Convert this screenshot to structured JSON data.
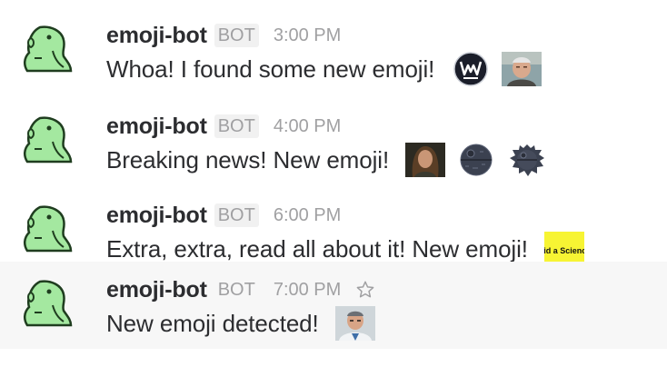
{
  "messages": [
    {
      "username": "emoji-bot",
      "badge": "BOT",
      "time": "3:00 PM",
      "text": "Whoa! I found some new emoji!",
      "emoji": [
        "westworld-logo-emoji",
        "old-man-portrait-emoji"
      ]
    },
    {
      "username": "emoji-bot",
      "badge": "BOT",
      "time": "4:00 PM",
      "text": "Breaking news! New emoji!",
      "emoji": [
        "woman-portrait-emoji",
        "death-star-emoji",
        "death-star-explosion-emoji"
      ]
    },
    {
      "username": "emoji-bot",
      "badge": "BOT",
      "time": "6:00 PM",
      "text": "Extra, extra, read all about it! New emoji!",
      "emoji": [
        "did-a-science-emoji"
      ],
      "emoji_text": "Did a Science"
    },
    {
      "username": "emoji-bot",
      "badge": "BOT",
      "time": "7:00 PM",
      "text": "New emoji detected!",
      "emoji": [
        "scientist-portrait-emoji"
      ],
      "hovered": true
    }
  ],
  "colors": {
    "username": "#2c2d30",
    "meta": "#a0a0a2",
    "hover_bg": "#f7f7f7",
    "parrot_green": "#a4e8a0",
    "parrot_outline": "#1f3d1f",
    "science_yellow": "#f7f433"
  },
  "icons": {
    "avatar": "parrot-avatar-icon",
    "star": "star-outline-icon"
  }
}
